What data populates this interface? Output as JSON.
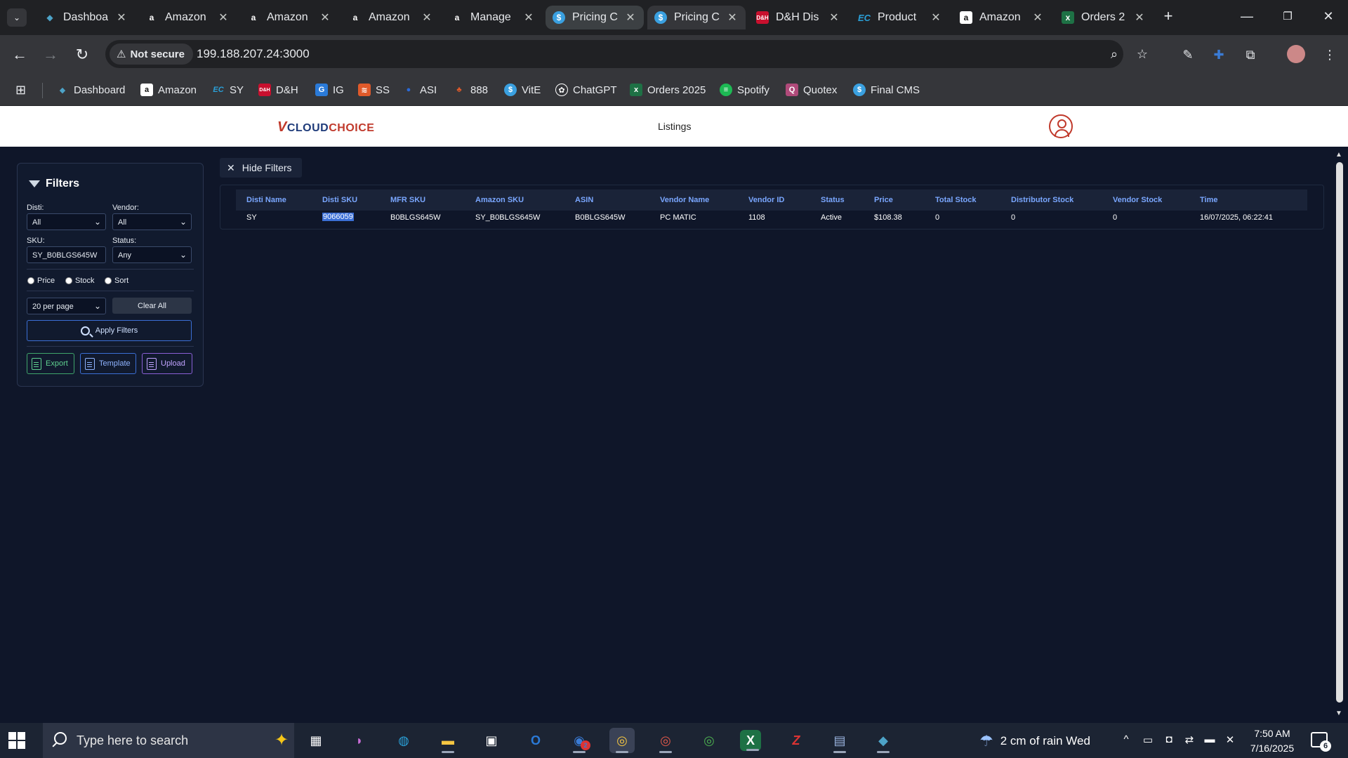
{
  "browser": {
    "tabs": [
      {
        "label": "Dashboa",
        "icon": "diamond-icon",
        "color": "#4da3c8"
      },
      {
        "label": "Amazon",
        "icon": "amazon-icon",
        "color": "#ffffff"
      },
      {
        "label": "Amazon",
        "icon": "amazon-icon",
        "color": "#ffffff"
      },
      {
        "label": "Amazon",
        "icon": "amazon-icon",
        "color": "#ffffff"
      },
      {
        "label": "Manage",
        "icon": "amazon-icon",
        "color": "#ffffff"
      },
      {
        "label": "Pricing C",
        "icon": "dollar-icon",
        "color": "#3aa0e0"
      },
      {
        "label": "Pricing C",
        "icon": "dollar-icon",
        "color": "#3aa0e0"
      },
      {
        "label": "D&H Dis",
        "icon": "dh-icon",
        "color": "#c8102e"
      },
      {
        "label": "Product",
        "icon": "ec-icon",
        "color": "#2aa0d8"
      },
      {
        "label": "Amazon",
        "icon": "amazon-icon",
        "color": "#ffffff"
      },
      {
        "label": "Orders 2",
        "icon": "excel-icon",
        "color": "#1e7145"
      }
    ],
    "not_secure": "Not secure",
    "url": "199.188.207.24:3000",
    "bookmarks": [
      {
        "label": "Dashboard",
        "icon": "diamond-icon",
        "color": "#4da3c8"
      },
      {
        "label": "Amazon",
        "icon": "amazon-icon",
        "color": "#232f3e"
      },
      {
        "label": "SY",
        "icon": "ec-icon",
        "color": "#2aa0d8"
      },
      {
        "label": "D&H",
        "icon": "dh-icon",
        "color": "#c8102e"
      },
      {
        "label": "IG",
        "icon": "ig-icon",
        "color": "#2a7ad8"
      },
      {
        "label": "SS",
        "icon": "ss-icon",
        "color": "#e05a2a"
      },
      {
        "label": "ASI",
        "icon": "asi-icon",
        "color": "#2a6ad8"
      },
      {
        "label": "888",
        "icon": "888-icon",
        "color": "#e05a2a"
      },
      {
        "label": "VitE",
        "icon": "dollar-icon",
        "color": "#3aa0e0"
      },
      {
        "label": "ChatGPT",
        "icon": "chatgpt-icon",
        "color": "#ffffff"
      },
      {
        "label": "Orders 2025",
        "icon": "excel-icon",
        "color": "#1e7145"
      },
      {
        "label": "Spotify",
        "icon": "spotify-icon",
        "color": "#1db954"
      },
      {
        "label": "Quotex",
        "icon": "quotex-icon",
        "color": "#b04a7a"
      },
      {
        "label": "Final CMS",
        "icon": "dollar-icon",
        "color": "#3aa0e0"
      }
    ]
  },
  "header": {
    "logo": {
      "v": "V",
      "cloud": "CLOUD",
      "choice": "CHOICE"
    },
    "nav_listings": "Listings"
  },
  "filters": {
    "title": "Filters",
    "disti_label": "Disti:",
    "disti_value": "All",
    "vendor_label": "Vendor:",
    "vendor_value": "All",
    "sku_label": "SKU:",
    "sku_value": "SY_B0BLGS645W",
    "status_label": "Status:",
    "status_value": "Any",
    "radio_price": "Price",
    "radio_stock": "Stock",
    "radio_sort": "Sort",
    "per_page": "20 per page",
    "clear_all": "Clear All",
    "apply": "Apply Filters",
    "export": "Export",
    "template": "Template",
    "upload": "Upload"
  },
  "hide_filters": "Hide Filters",
  "table": {
    "headers": [
      "Disti Name",
      "Disti SKU",
      "MFR SKU",
      "Amazon SKU",
      "ASIN",
      "Vendor Name",
      "Vendor ID",
      "Status",
      "Price",
      "Total Stock",
      "Distributor Stock",
      "Vendor Stock",
      "Time"
    ],
    "rows": [
      [
        "SY",
        "9066059",
        "B0BLGS645W",
        "SY_B0BLGS645W",
        "B0BLGS645W",
        "PC MATIC",
        "1108",
        "Active",
        "$108.38",
        "0",
        "0",
        "0",
        "16/07/2025, 06:22:41"
      ]
    ]
  },
  "taskbar": {
    "search_placeholder": "Type here to search",
    "weather": "2 cm of rain Wed",
    "time": "7:50 AM",
    "date": "7/16/2025",
    "notifications": "6",
    "outlook_badge": "2"
  }
}
